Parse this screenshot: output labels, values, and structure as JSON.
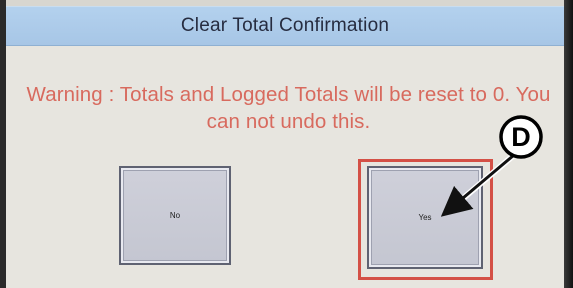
{
  "dialog": {
    "title": "Clear Total Confirmation",
    "warning": "Warning : Totals and Logged Totals will be reset to 0. You can not undo this."
  },
  "buttons": {
    "no_label": "No",
    "yes_label": "Yes"
  },
  "callout": {
    "label": "D"
  },
  "colors": {
    "title_bar": "#a9c8e8",
    "warning_text": "#d86a5e",
    "highlight": "#d45046",
    "button_face": "#c9cbd5",
    "background": "#e7e5df"
  }
}
